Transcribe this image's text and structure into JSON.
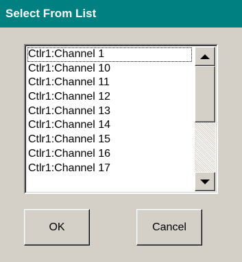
{
  "window": {
    "title": "Select From List"
  },
  "list": {
    "items": [
      "Ctlr1:Channel 1",
      "Ctlr1:Channel 10",
      "Ctlr1:Channel 11",
      "Ctlr1:Channel 12",
      "Ctlr1:Channel 13",
      "Ctlr1:Channel 14",
      "Ctlr1:Channel 15",
      "Ctlr1:Channel 16",
      "Ctlr1:Channel 17"
    ],
    "focused_index": 0
  },
  "scrollbar": {
    "up_icon": "arrow-up-icon",
    "down_icon": "arrow-down-icon"
  },
  "buttons": {
    "ok_label": "OK",
    "cancel_label": "Cancel"
  },
  "colors": {
    "titlebar": "#008080",
    "face": "#d4d0c8",
    "list_background": "#ffffff"
  }
}
